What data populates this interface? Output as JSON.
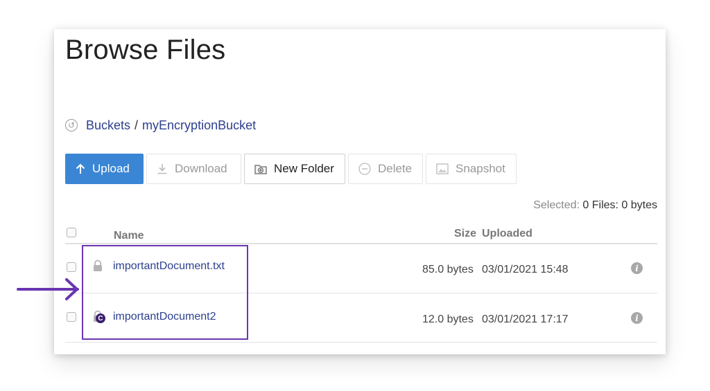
{
  "page": {
    "title": "Browse Files"
  },
  "breadcrumb": {
    "root": "Buckets",
    "separator": "/",
    "bucket": "myEncryptionBucket",
    "icon": "back-circle-icon"
  },
  "toolbar": {
    "upload": "Upload",
    "download": "Download",
    "new_folder": "New Folder",
    "delete": "Delete",
    "snapshot": "Snapshot"
  },
  "selection": {
    "label": "Selected:",
    "value": "0 Files: 0 bytes"
  },
  "table": {
    "columns": {
      "name": "Name",
      "size": "Size",
      "uploaded": "Uploaded"
    },
    "rows": [
      {
        "name": "importantDocument.txt",
        "size": "85.0 bytes",
        "uploaded": "03/01/2021 15:48",
        "icon": "lock-icon"
      },
      {
        "name": "importantDocument2",
        "size": "12.0 bytes",
        "uploaded": "03/01/2021 17:17",
        "icon": "lock-icon",
        "badge": "C"
      }
    ]
  },
  "colors": {
    "accent": "#3a86d4",
    "link": "#2c3f8f",
    "highlight": "#6a35b0",
    "badge": "#3b1f6b"
  }
}
